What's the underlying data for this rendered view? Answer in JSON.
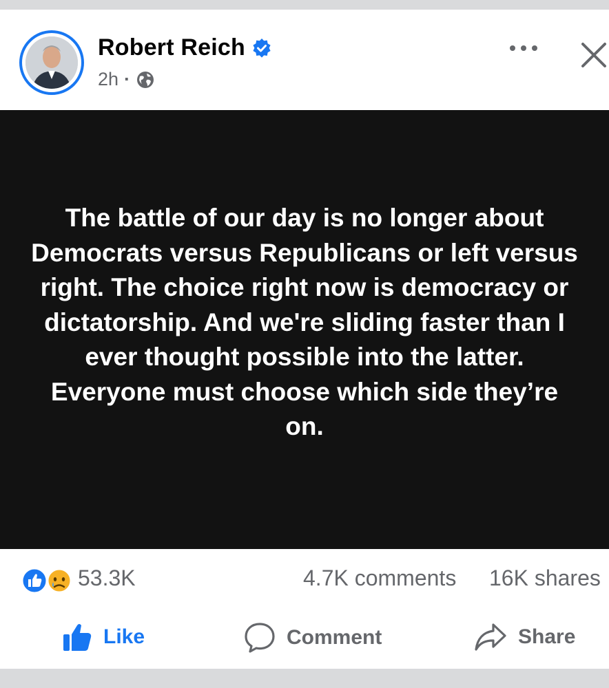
{
  "post": {
    "author": "Robert Reich",
    "time": "2h",
    "meta_separator": "·",
    "text": "The battle of our day is no longer about Democrats versus Republicans or left versus right. The choice right now is democracy or dictatorship. And we're sliding faster than I ever thought possible into the latter. Everyone must choose which side they’re on."
  },
  "stats": {
    "reactions": "53.3K",
    "comments": "4.7K comments",
    "shares": "16K shares"
  },
  "actions": {
    "like": "Like",
    "comment": "Comment",
    "share": "Share"
  },
  "colors": {
    "accent": "#1877f2",
    "post_background": "#121212",
    "secondary_text": "#65676b"
  },
  "icons": [
    "verified-badge-icon",
    "globe-icon",
    "more-options-icon",
    "close-icon",
    "like-reaction-icon",
    "sad-reaction-icon",
    "thumbs-up-icon",
    "comment-icon",
    "share-icon"
  ]
}
